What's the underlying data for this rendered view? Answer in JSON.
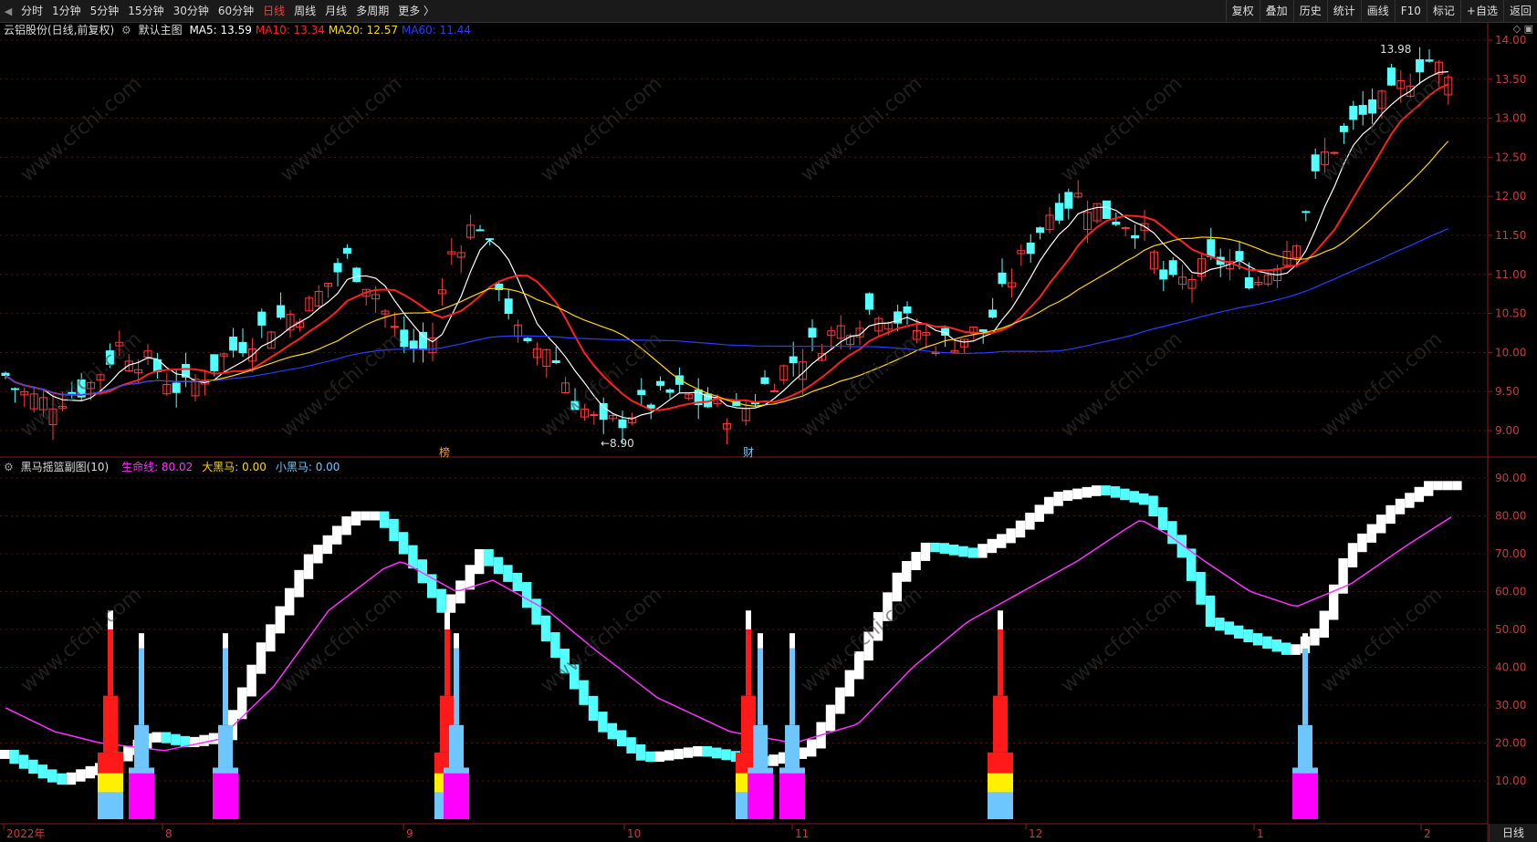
{
  "toolbar": {
    "left": [
      "分时",
      "1分钟",
      "5分钟",
      "15分钟",
      "30分钟",
      "60分钟",
      "日线",
      "周线",
      "月线",
      "多周期",
      "更多 〉"
    ],
    "active": "日线",
    "right": [
      "复权",
      "叠加",
      "历史",
      "统计",
      "画线",
      "F10",
      "+自选",
      "返回"
    ],
    "mark": "标记"
  },
  "main": {
    "stock": "云铝股份(日线,前复权)",
    "template": "默认主图",
    "ma": [
      {
        "label": "MA5: 13.59",
        "color": "#ffffff"
      },
      {
        "label": "MA10: 13.34",
        "color": "#ff2020"
      },
      {
        "label": "MA20: 12.57",
        "color": "#ffd700"
      },
      {
        "label": "MA60: 11.44",
        "color": "#2a3cff"
      }
    ],
    "high_label": "13.98",
    "low_label": "←8.90",
    "events": [
      "榜",
      "财"
    ],
    "yticks": [
      "14.00",
      "13.50",
      "13.00",
      "12.50",
      "12.00",
      "11.50",
      "11.00",
      "10.50",
      "10.00",
      "9.50",
      "9.00"
    ]
  },
  "sub": {
    "title": "黑马摇篮副图(10)",
    "lines": [
      {
        "label": "生命线: 80.02",
        "color": "#ff30ff"
      },
      {
        "label": "大黑马: 0.00",
        "color": "#ffd700"
      },
      {
        "label": "小黑马: 0.00",
        "color": "#6ec6ff"
      }
    ],
    "yticks": [
      "90.00",
      "80.00",
      "70.00",
      "60.00",
      "50.00",
      "40.00",
      "30.00",
      "20.00",
      "10.00"
    ]
  },
  "xaxis": [
    "2022年",
    "8",
    "9",
    "10",
    "11",
    "12",
    "1",
    "2"
  ],
  "period_button": "日线",
  "watermark": "www.cfchi.com"
}
